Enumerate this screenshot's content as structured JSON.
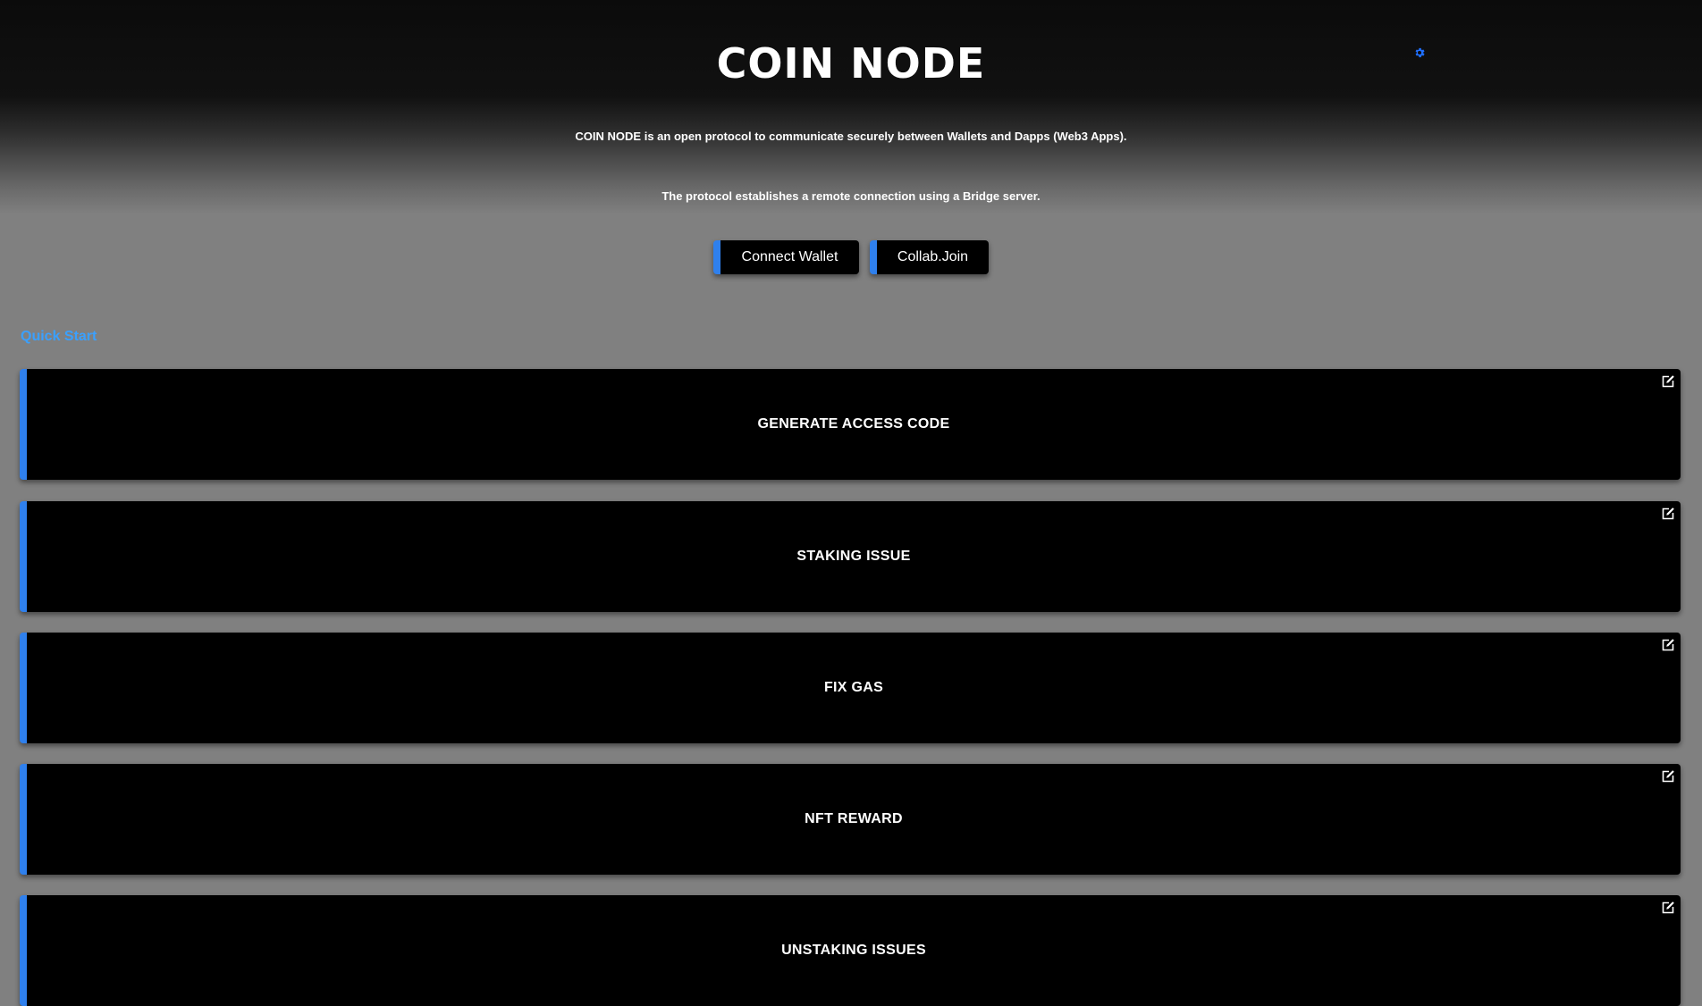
{
  "header": {
    "title": "COIN NODE",
    "settings_icon": "gear-icon",
    "accent_color": "#2f80ed"
  },
  "intro": {
    "line1": "COIN NODE is an open protocol to communicate securely between Wallets and Dapps (Web3 Apps).",
    "line2": "The protocol establishes a remote connection using a Bridge server."
  },
  "buttons": {
    "connect_wallet": "Connect Wallet",
    "collab_join": "Collab.Join"
  },
  "quick_start": {
    "label": "Quick Start",
    "label_color": "#3aa0ff",
    "items": [
      {
        "label": "GENERATE ACCESS CODE",
        "icon": "external-edit-icon"
      },
      {
        "label": "STAKING ISSUE",
        "icon": "external-edit-icon"
      },
      {
        "label": "FIX GAS",
        "icon": "external-edit-icon"
      },
      {
        "label": "NFT REWARD",
        "icon": "external-edit-icon"
      },
      {
        "label": "UNSTAKING ISSUES",
        "icon": "external-edit-icon"
      }
    ]
  }
}
